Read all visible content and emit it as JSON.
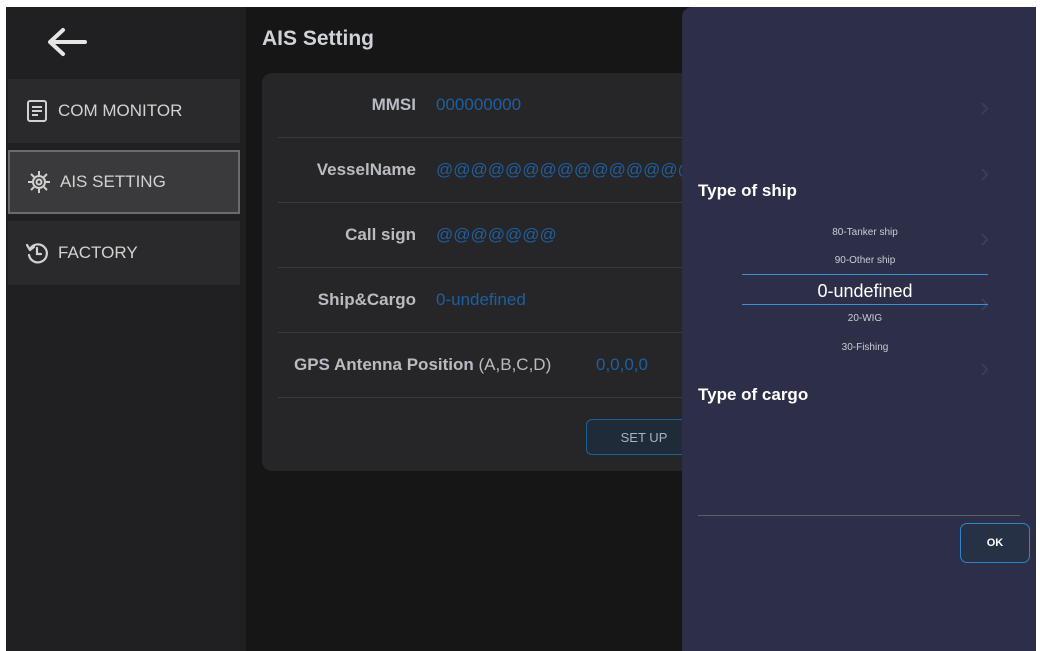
{
  "sidebar": {
    "items": [
      {
        "label": "COM MONITOR"
      },
      {
        "label": "AIS SETTING"
      },
      {
        "label": "FACTORY"
      }
    ]
  },
  "page": {
    "title": "AIS Setting"
  },
  "form": {
    "mmsi": {
      "label": "MMSI",
      "value": "000000000"
    },
    "vessel_name": {
      "label": "VesselName",
      "value": "@@@@@@@@@@@@@@@@@@@@"
    },
    "call_sign": {
      "label": "Call sign",
      "value": "@@@@@@@"
    },
    "ship_cargo": {
      "label": "Ship&Cargo",
      "value": "0-undefined"
    },
    "gps": {
      "label": "GPS Antenna Position",
      "label_suffix": "(A,B,C,D)",
      "value": "0,0,0,0"
    },
    "setup_label": "SET UP"
  },
  "dialog": {
    "ship_heading": "Type of ship",
    "ship_options": [
      "80-Tanker ship",
      "90-Other ship",
      "0-undefined",
      "20-WIG",
      "30-Fishing"
    ],
    "cargo_heading": "Type of cargo",
    "ok_label": "OK"
  },
  "colors": {
    "accent": "#1e5fa0",
    "dialog_bg": "#2c2f47",
    "picker_line": "#3b8fd6"
  }
}
